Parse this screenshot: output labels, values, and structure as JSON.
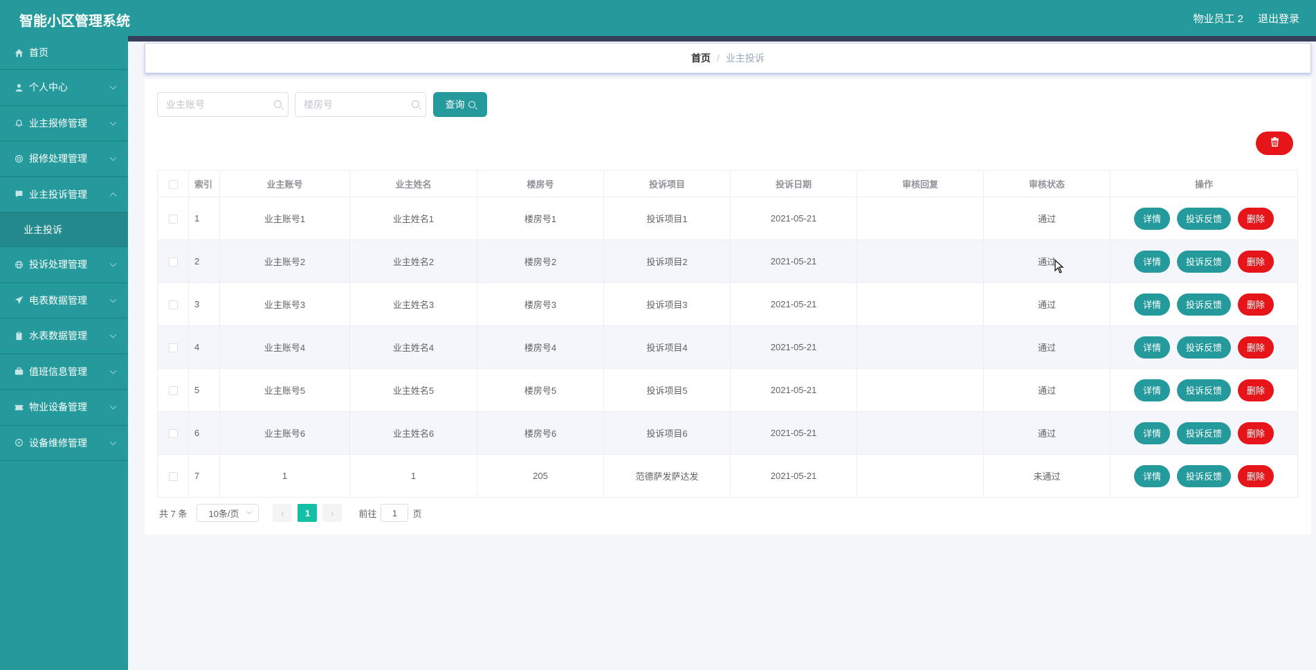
{
  "app": {
    "title": "智能小区管理系统",
    "user": "物业员工 2",
    "logout": "退出登录"
  },
  "sidebar": {
    "items": [
      {
        "label": "首页",
        "icon": "home-icon"
      },
      {
        "label": "个人中心",
        "icon": "user-icon"
      },
      {
        "label": "业主报修管理",
        "icon": "bell-icon"
      },
      {
        "label": "报修处理管理",
        "icon": "lifebuoy-icon"
      },
      {
        "label": "业主投诉管理",
        "icon": "chat-icon"
      },
      {
        "label": "业主投诉",
        "icon": ""
      },
      {
        "label": "投诉处理管理",
        "icon": "globe-icon"
      },
      {
        "label": "电表数据管理",
        "icon": "send-icon"
      },
      {
        "label": "水表数据管理",
        "icon": "clipboard-icon"
      },
      {
        "label": "值班信息管理",
        "icon": "briefcase-icon"
      },
      {
        "label": "物业设备管理",
        "icon": "ticket-icon"
      },
      {
        "label": "设备维修管理",
        "icon": "compass-icon"
      }
    ]
  },
  "breadcrumb": {
    "home": "首页",
    "sep": "/",
    "current": "业主投诉"
  },
  "search": {
    "account_placeholder": "业主账号",
    "room_placeholder": "楼房号",
    "button": "查询"
  },
  "table": {
    "headers": [
      "索引",
      "业主账号",
      "业主姓名",
      "楼房号",
      "投诉项目",
      "投诉日期",
      "审核回复",
      "审核状态",
      "操作"
    ],
    "rows": [
      {
        "index": "1",
        "account": "业主账号1",
        "name": "业主姓名1",
        "room": "楼房号1",
        "item": "投诉项目1",
        "date": "2021-05-21",
        "reply": "",
        "status": "通过"
      },
      {
        "index": "2",
        "account": "业主账号2",
        "name": "业主姓名2",
        "room": "楼房号2",
        "item": "投诉项目2",
        "date": "2021-05-21",
        "reply": "",
        "status": "通过"
      },
      {
        "index": "3",
        "account": "业主账号3",
        "name": "业主姓名3",
        "room": "楼房号3",
        "item": "投诉项目3",
        "date": "2021-05-21",
        "reply": "",
        "status": "通过"
      },
      {
        "index": "4",
        "account": "业主账号4",
        "name": "业主姓名4",
        "room": "楼房号4",
        "item": "投诉项目4",
        "date": "2021-05-21",
        "reply": "",
        "status": "通过"
      },
      {
        "index": "5",
        "account": "业主账号5",
        "name": "业主姓名5",
        "room": "楼房号5",
        "item": "投诉项目5",
        "date": "2021-05-21",
        "reply": "",
        "status": "通过"
      },
      {
        "index": "6",
        "account": "业主账号6",
        "name": "业主姓名6",
        "room": "楼房号6",
        "item": "投诉项目6",
        "date": "2021-05-21",
        "reply": "",
        "status": "通过"
      },
      {
        "index": "7",
        "account": "1",
        "name": "1",
        "room": "205",
        "item": "范德萨发萨达发",
        "date": "2021-05-21",
        "reply": "",
        "status": "未通过"
      }
    ],
    "actions": {
      "detail": "详情",
      "feedback": "投诉反馈",
      "delete": "删除"
    }
  },
  "pagination": {
    "total": "共 7 条",
    "page_size": "10条/页",
    "current_page": "1",
    "goto_label": "前往",
    "goto_value": "1",
    "page_suffix": "页"
  },
  "colors": {
    "primary": "#259a9d",
    "danger": "#e5151a",
    "active_page": "#13c0a6",
    "topbar_strip": "#37405a"
  }
}
